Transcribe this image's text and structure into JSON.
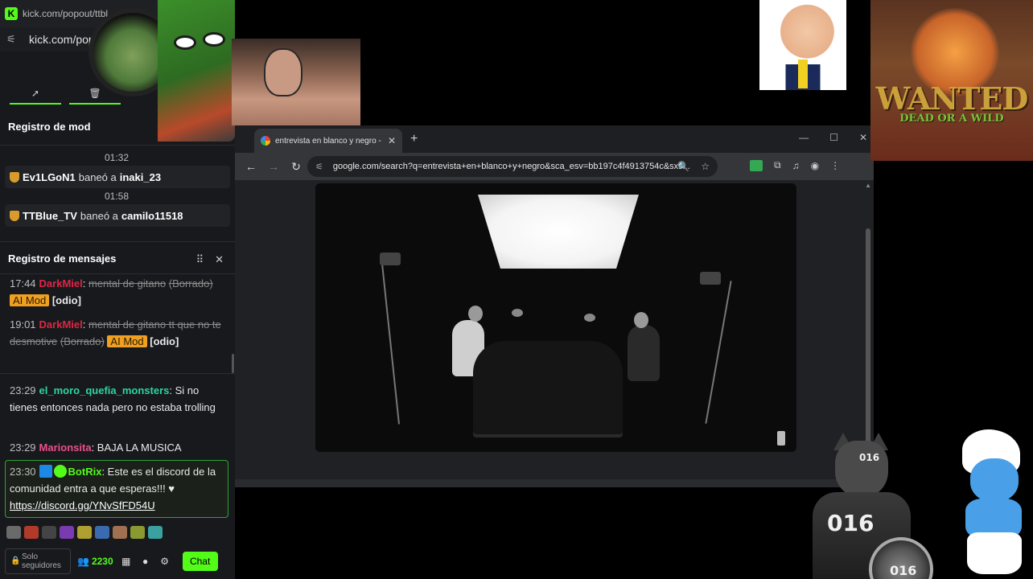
{
  "left_panel": {
    "url_small": "kick.com/popout/ttbl",
    "url_big": "kick.com/pop",
    "tool_buttons": [
      "pin-icon",
      "trash-icon"
    ],
    "mod_log": {
      "title": "Registro de mod",
      "entries": [
        {
          "time": "01:32",
          "moderator": "Ev1LGoN1",
          "action": "baneó a",
          "target": "inaki_23"
        },
        {
          "time": "01:58",
          "moderator": "TTBlue_TV",
          "action": "baneó a",
          "target": "camilo11518"
        }
      ]
    },
    "message_log": {
      "title": "Registro de mensajes",
      "messages": [
        {
          "time": "17:44",
          "user": "DarkMiel",
          "text": "mental de gitano",
          "deleted": "(Borrado)",
          "badge": "AI Mod",
          "tag": "[odio]"
        },
        {
          "time": "19:01",
          "user": "DarkMiel",
          "text": "mental de gitano tt que no te desmotive",
          "deleted": "(Borrado)",
          "badge": "AI Mod",
          "tag": "[odio]"
        },
        {
          "time": "23:29",
          "user": "el_moro_quefia_monsters",
          "text": "Si no tienes entonces nada pero no estaba trolling"
        },
        {
          "time": "23:29",
          "user": "Marionsita",
          "text": "BAJA LA MUSICA"
        },
        {
          "time": "23:30",
          "user": "BotRix",
          "text": "Este es el discord de la comunidad entra a que esperas!!! ♥",
          "link": "https://discord.gg/YNvSfFD54U"
        }
      ]
    },
    "bottom": {
      "followers_label_1": "Solo",
      "followers_label_2": "seguidores",
      "viewer_count": "2230",
      "chat_button": "Chat"
    }
  },
  "browser": {
    "tab_title": "entrevista en blanco y negro - ",
    "url": "google.com/search?q=entrevista+en+blanco+y+negro&sca_esv=bb197c4f4913754c&sxs...",
    "colors": {
      "tab_bg": "#35363a",
      "frame": "#202124"
    }
  },
  "overlays": {
    "wanted_title": "WANTED",
    "wanted_sub": "DEAD OR A WILD",
    "cat_number": "016"
  },
  "colors": {
    "kick_green": "#53fc18",
    "ai_mod_badge": "#f0a020"
  }
}
